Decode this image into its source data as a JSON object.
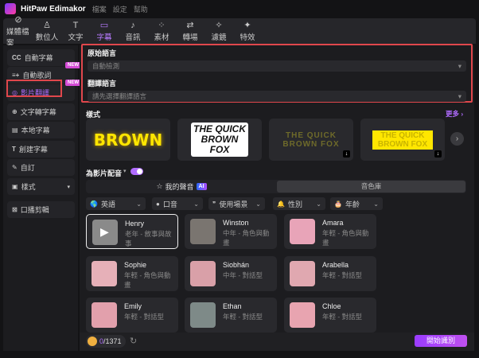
{
  "app": {
    "title": "HitPaw Edimakor",
    "menu": [
      "檔案",
      "設定",
      "幫助"
    ]
  },
  "toolbar": [
    {
      "label": "媒體檔案",
      "icon": "media-icon"
    },
    {
      "label": "數位人",
      "icon": "avatar-icon"
    },
    {
      "label": "文字",
      "icon": "text-icon"
    },
    {
      "label": "字幕",
      "icon": "subtitle-icon",
      "active": true
    },
    {
      "label": "音訊",
      "icon": "audio-icon"
    },
    {
      "label": "素材",
      "icon": "assets-icon"
    },
    {
      "label": "轉場",
      "icon": "transition-icon"
    },
    {
      "label": "濾鏡",
      "icon": "filter-icon"
    },
    {
      "label": "特效",
      "icon": "effects-icon"
    }
  ],
  "sidebar": {
    "items": [
      {
        "label": "自動字幕",
        "icon": "CC"
      },
      {
        "label": "自動歌詞",
        "icon": "≡+"
      },
      {
        "label": "影片翻譯",
        "icon": "◎",
        "active": true
      },
      {
        "label": "文字轉字幕",
        "icon": "⊕"
      },
      {
        "label": "本地字幕",
        "icon": "▤"
      },
      {
        "label": "創建字幕",
        "icon": "T"
      },
      {
        "label": "自訂",
        "icon": "✎"
      },
      {
        "label": "樣式",
        "icon": "▣"
      },
      {
        "label": "口播剪輯",
        "icon": "⊠"
      }
    ],
    "badge": "NEW"
  },
  "translate": {
    "source_label": "原始語言",
    "source_value": "自動檢測",
    "target_label": "翻譯語言",
    "target_placeholder": "請先選擇翻譯語言"
  },
  "styles": {
    "label": "樣式",
    "more": "更多",
    "cards": [
      "BROWN",
      "THE QUICK BROWN FOX",
      "THE QUICK BROWN FOX",
      "THE QUICK BROWN FOX"
    ]
  },
  "dubbing": {
    "label": "為影片配音",
    "enabled": true,
    "tab_my_voice": "我的聲音",
    "ai_badge": "AI",
    "tab_library": "音色庫"
  },
  "filters": [
    {
      "label": "英語",
      "icon": "🌎"
    },
    {
      "label": "口音",
      "icon": "●"
    },
    {
      "label": "使用場景",
      "icon": "❞"
    },
    {
      "label": "性別",
      "icon": "🔔"
    },
    {
      "label": "年齡",
      "icon": "🎂"
    }
  ],
  "voices": [
    {
      "name": "Henry",
      "desc": "老年 - 敘事與故事",
      "color": "#8a8a8a"
    },
    {
      "name": "Winston",
      "desc": "中年 - 角色與動畫",
      "color": "#7a7570"
    },
    {
      "name": "Amara",
      "desc": "年輕 - 角色與動畫",
      "color": "#e8a4b8"
    },
    {
      "name": "Sophie",
      "desc": "年輕 - 角色與動畫",
      "color": "#e6b0b8"
    },
    {
      "name": "Siobhán",
      "desc": "中年 - 對話型",
      "color": "#d9a0a8"
    },
    {
      "name": "Arabella",
      "desc": "年輕 - 對話型",
      "color": "#e0a8b0"
    },
    {
      "name": "Emily",
      "desc": "年輕 - 對話型",
      "color": "#e2a0ac"
    },
    {
      "name": "Ethan",
      "desc": "年輕 - 對話型",
      "color": "#7e8a88"
    },
    {
      "name": "Chloe",
      "desc": "年輕 - 對話型",
      "color": "#e8a4b0"
    }
  ],
  "footer": {
    "credits_used": "0",
    "credits_total": "/1371",
    "start_button": "開始識別"
  },
  "colors": {
    "accent": "#b06cff",
    "highlight": "#e0474c"
  }
}
